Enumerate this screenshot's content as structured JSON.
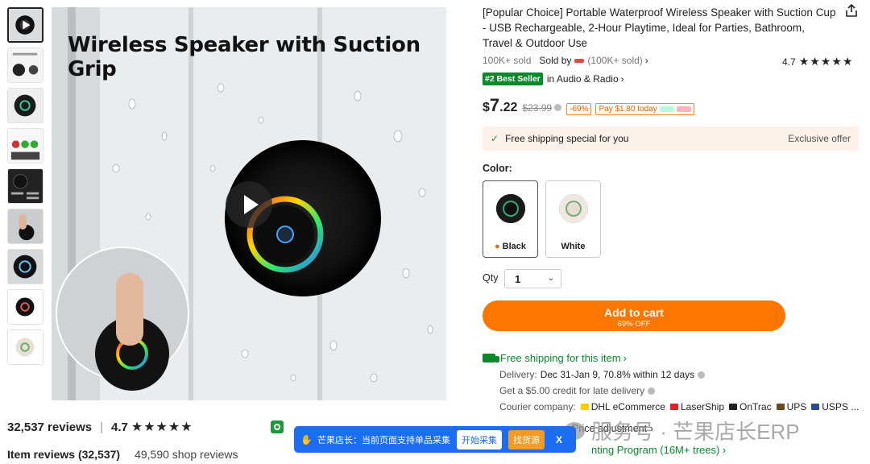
{
  "thumbnails": [
    {
      "name": "thumb-video",
      "active": true
    },
    {
      "name": "thumb-product-details"
    },
    {
      "name": "thumb-device-front"
    },
    {
      "name": "thumb-usage-grid"
    },
    {
      "name": "thumb-features"
    },
    {
      "name": "thumb-hand-use"
    },
    {
      "name": "thumb-speaker-close"
    },
    {
      "name": "thumb-black-variant"
    },
    {
      "name": "thumb-white-variant"
    }
  ],
  "hero": {
    "title": "Wireless Speaker with Suction Grip"
  },
  "product": {
    "title": "[Popular Choice] Portable Waterproof Wireless Speaker with Suction Cup - USB Rechargeable, 2-Hour Playtime, Ideal for Parties, Bathroom, Travel & Outdoor Use",
    "sold": "100K+ sold",
    "sold_by_label": "Sold by",
    "sold_by_count": "(100K+ sold)",
    "chevron": "›",
    "rating": "4.7",
    "stars": "★★★★★",
    "best_seller_badge": "#2 Best Seller",
    "best_seller_category": "in Audio & Radio",
    "price": {
      "currency": "$",
      "integer": "7",
      "decimal": ".22",
      "original": "$23.99",
      "discount": "-69%",
      "pay_today": "Pay $1.80 today"
    },
    "shipping_banner": {
      "text": "Free shipping special for you",
      "exclusive": "Exclusive offer"
    },
    "color_label": "Color:",
    "colors": [
      {
        "label": "Black",
        "selected": true,
        "hot": true
      },
      {
        "label": "White",
        "selected": false
      }
    ],
    "qty_label": "Qty",
    "qty_value": "1",
    "add_to_cart": {
      "label": "Add to cart",
      "sub": "69% OFF"
    }
  },
  "shipping": {
    "free_shipping": "Free shipping for this item",
    "delivery_label": "Delivery:",
    "delivery_value": "Dec 31-Jan 9, 70.8% within 12 days",
    "credit": "Get a $5.00 credit for late delivery",
    "courier_label": "Courier company:",
    "couriers": [
      "DHL eCommerce",
      "LaserShip",
      "OnTrac",
      "UPS",
      "USPS ..."
    ],
    "price_adjustment": "Price adjustment ›",
    "green_program": "nting Program (16M+ trees) ›"
  },
  "reviews": {
    "count": "32,537 reviews",
    "separator": "|",
    "rating": "4.7",
    "stars": "★★★★★",
    "item_reviews": "Item reviews (32,537)",
    "shop_reviews": "49,590 shop reviews"
  },
  "toolbar": {
    "text": "芒果店长：当前页面支持单品采集",
    "collect": "开始采集",
    "find_source": "找货源",
    "close": "X"
  },
  "watermark": {
    "text": "服务号 · 芒果店长ERP"
  },
  "colors": {
    "accent": "#fb7701",
    "green": "#0a8a2a",
    "toolbar": "#1b6ef3"
  }
}
